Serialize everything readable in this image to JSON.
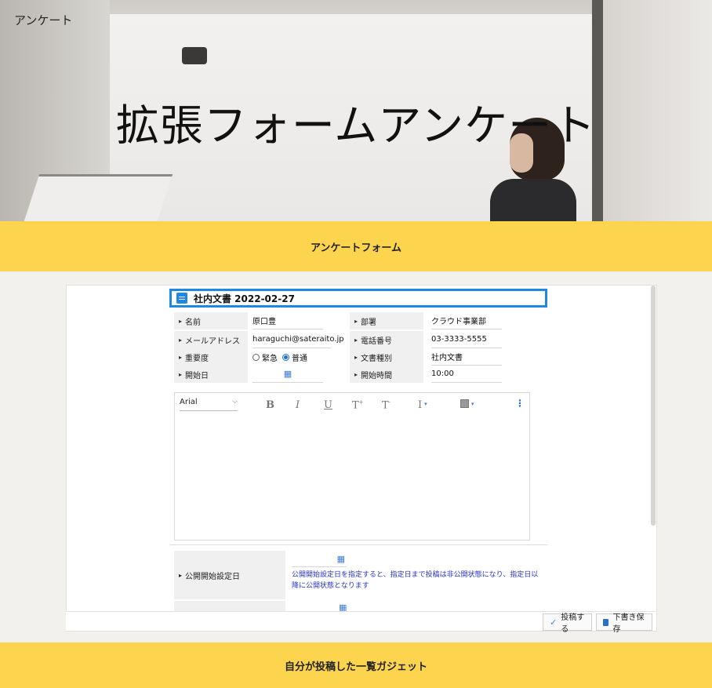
{
  "brand": "アンケート",
  "hero_title": "拡張フォームアンケート",
  "section_band": "アンケートフォーム",
  "bottom_band": "自分が投稿した一覧ガジェット",
  "doc_title": "社内文書 2022-02-27",
  "fields": {
    "name": {
      "label": "名前",
      "value": "原口豊"
    },
    "dept": {
      "label": "部署",
      "value": "クラウド事業部"
    },
    "email": {
      "label": "メールアドレス",
      "value": "haraguchi@sateraito.jp"
    },
    "phone": {
      "label": "電話番号",
      "value": "03-3333-5555"
    },
    "priority": {
      "label": "重要度",
      "options": [
        "緊急",
        "普通"
      ],
      "selected": "普通"
    },
    "doc_type": {
      "label": "文書種別",
      "value": "社内文書"
    },
    "start_date": {
      "label": "開始日",
      "value": ""
    },
    "start_time": {
      "label": "開始時間",
      "value": "10:00"
    }
  },
  "editor": {
    "font": "Arial",
    "tools": [
      "B",
      "I",
      "U",
      "T",
      "T",
      "I"
    ]
  },
  "publish": {
    "label": "公開開始設定日",
    "hint": "公開開始設定日を指定すると、指定日まで投稿は非公開状態になり、指定日以降に公開状態となります"
  },
  "buttons": {
    "submit": "投稿する",
    "draft": "下書き保存"
  },
  "colors": {
    "accent": "#fdd44e",
    "primary": "#1e88e5",
    "hint": "#2733c9"
  }
}
